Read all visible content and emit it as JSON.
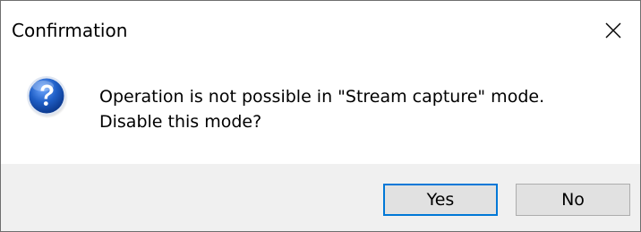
{
  "dialog": {
    "title": "Confirmation",
    "message_lines": [
      "Operation is not possible in \"Stream capture\" mode.",
      "Disable this mode?"
    ],
    "icon": "question-icon",
    "close_icon": "close-icon"
  },
  "buttons": {
    "yes_label": "Yes",
    "no_label": "No"
  },
  "colors": {
    "accent": "#0078d7",
    "footer_background": "#f0f0f0",
    "button_background": "#e1e1e1"
  }
}
